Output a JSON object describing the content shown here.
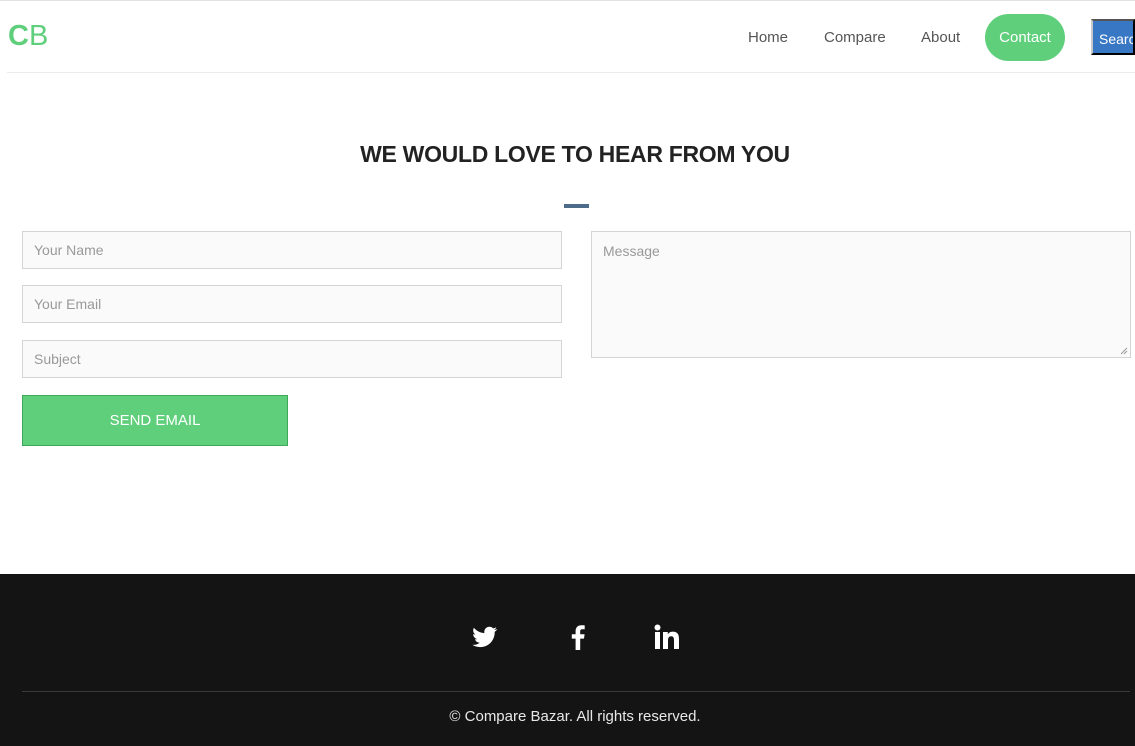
{
  "brand": {
    "letter1": "C",
    "letter2": "B"
  },
  "nav": {
    "home": "Home",
    "compare": "Compare",
    "about": "About",
    "contact": "Contact",
    "search": "Search"
  },
  "contact": {
    "heading": "WE WOULD LOVE TO HEAR FROM YOU",
    "name_placeholder": "Your Name",
    "email_placeholder": "Your Email",
    "subject_placeholder": "Subject",
    "message_placeholder": "Message",
    "send_label": "SEND EMAIL"
  },
  "footer": {
    "social": [
      "twitter-icon",
      "facebook-icon",
      "linkedin-icon"
    ],
    "copyright": "© Compare Bazar. All rights reserved."
  },
  "colors": {
    "brand_green": "#5fcf7c",
    "search_blue": "#3777c4",
    "heading_bar": "#4d6c8a",
    "footer_bg": "#141414"
  }
}
